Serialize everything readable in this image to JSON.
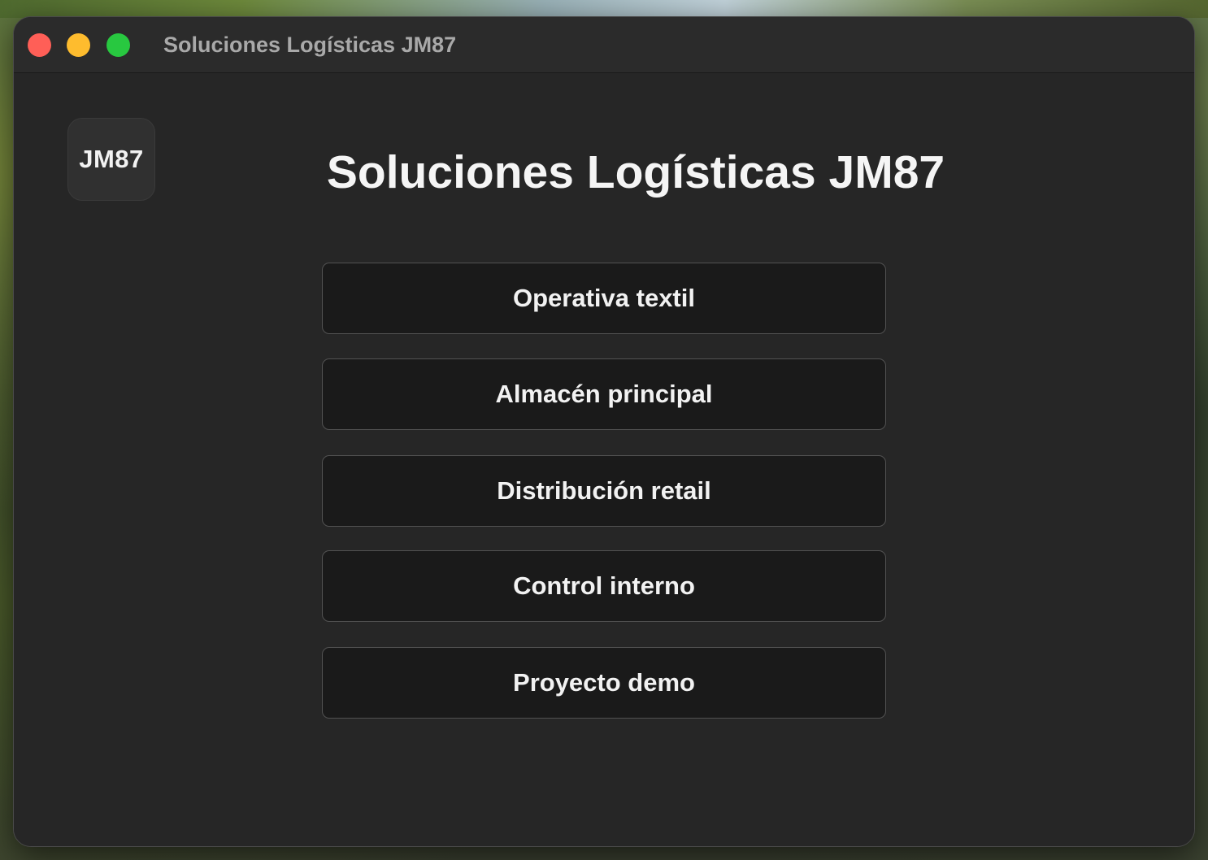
{
  "window": {
    "title": "Soluciones Logísticas JM87"
  },
  "logo": {
    "text": "JM87"
  },
  "main": {
    "title": "Soluciones Logísticas JM87",
    "buttons": [
      {
        "label": "Operativa textil"
      },
      {
        "label": "Almacén principal"
      },
      {
        "label": "Distribución retail"
      },
      {
        "label": "Control interno"
      },
      {
        "label": "Proyecto demo"
      }
    ]
  },
  "colors": {
    "close": "#ff5f57",
    "minimize": "#febc2e",
    "zoom": "#28c840",
    "window_bg": "#262626",
    "button_bg": "#1a1a1a"
  }
}
